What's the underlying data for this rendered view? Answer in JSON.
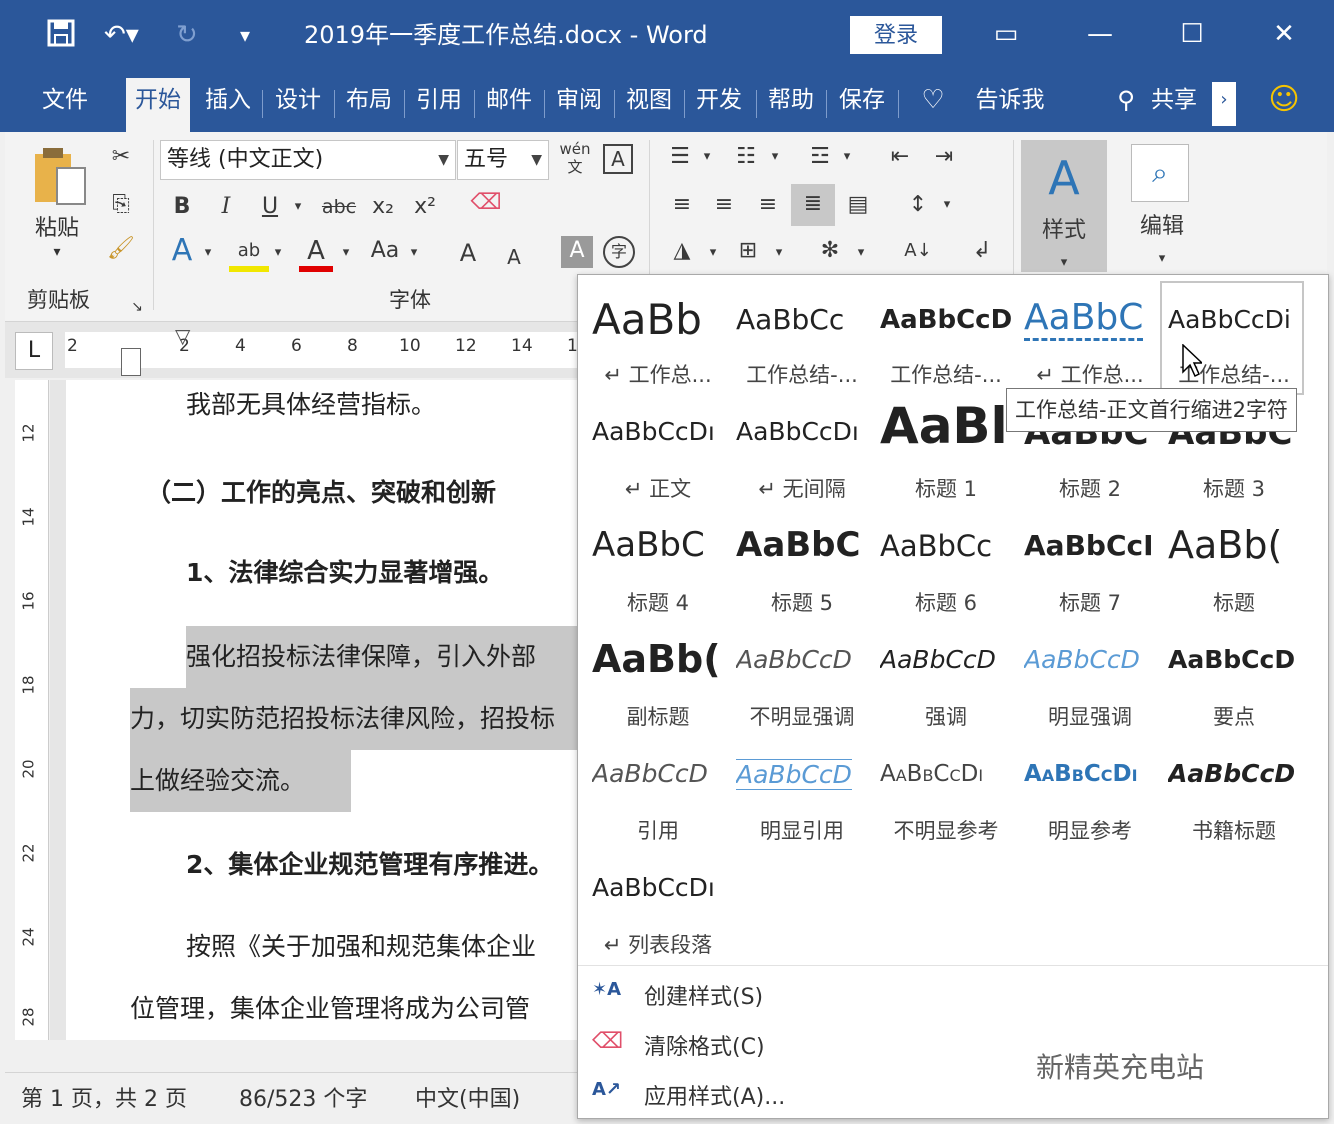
{
  "titlebar": {
    "title": "2019年一季度工作总结.docx  -  Word",
    "login": "登录",
    "save_icon": "save-icon",
    "undo_icon": "undo-icon",
    "redo_icon": "redo-icon"
  },
  "tabs": [
    "文件",
    "开始",
    "插入",
    "设计",
    "布局",
    "引用",
    "邮件",
    "审阅",
    "视图",
    "开发",
    "帮助",
    "保存"
  ],
  "active_tab": "开始",
  "tell_me": "告诉我",
  "share": "共享",
  "ribbon": {
    "paste": "粘贴",
    "clipboard": "剪贴板",
    "font_name": "等线 (中文正文)",
    "font_size": "五号",
    "font_group": "字体",
    "bold": "B",
    "italic": "I",
    "underline": "U",
    "strike": "abc",
    "sub": "x₂",
    "sup": "x²",
    "change_case": "Aa",
    "grow": "A",
    "shrink": "A",
    "styles": "样式",
    "editing": "编辑",
    "phonetic": "wén"
  },
  "ruler": {
    "corner": "L",
    "numbers": [
      "2",
      "2",
      "4",
      "6",
      "8",
      "10",
      "12",
      "14",
      "1"
    ],
    "vnumbers": [
      "12",
      "14",
      "16",
      "18",
      "20",
      "22",
      "24",
      "28"
    ]
  },
  "document": {
    "lines": [
      "我部无具体经营指标。",
      "（二）工作的亮点、突破和创新",
      "1、法律综合实力显著增强。",
      "强化招投标法律保障，引入外部",
      "力，切实防范招投标法律风险，招投标",
      "上做经验交流。",
      "2、集体企业规范管理有序推进。",
      "按照《关于加强和规范集体企业",
      "位管理，集体企业管理将成为公司管"
    ]
  },
  "statusbar": {
    "page": "第 1 页，共 2 页",
    "words": "86/523 个字",
    "lang": "中文(中国)"
  },
  "gallery": {
    "styles": [
      {
        "preview": "AaBb",
        "label": "↵ 工作总..."
      },
      {
        "preview": "AaBbCc",
        "label": "工作总结-..."
      },
      {
        "preview": "AaBbCcD",
        "label": "工作总结-..."
      },
      {
        "preview": "AaBbC",
        "label": "↵ 工作总..."
      },
      {
        "preview": "AaBbCcDi",
        "label": "工作总结-..."
      },
      {
        "preview": "AaBbCcDı",
        "label": "↵ 正文"
      },
      {
        "preview": "AaBbCcDı",
        "label": "↵ 无间隔"
      },
      {
        "preview": "AaBl",
        "label": "标题 1"
      },
      {
        "preview": "AaBbC",
        "label": "标题 2"
      },
      {
        "preview": "AaBbC",
        "label": "标题 3"
      },
      {
        "preview": "AaBbC",
        "label": "标题 4"
      },
      {
        "preview": "AaBbC",
        "label": "标题 5"
      },
      {
        "preview": "AaBbCc",
        "label": "标题 6"
      },
      {
        "preview": "AaBbCcI",
        "label": "标题 7"
      },
      {
        "preview": "AaBb(",
        "label": "标题"
      },
      {
        "preview": "AaBb(",
        "label": "副标题"
      },
      {
        "preview": "AaBbCcD",
        "label": "不明显强调"
      },
      {
        "preview": "AaBbCcD",
        "label": "强调"
      },
      {
        "preview": "AaBbCcD",
        "label": "明显强调"
      },
      {
        "preview": "AaBbCcD",
        "label": "要点"
      },
      {
        "preview": "AaBbCcD",
        "label": "引用"
      },
      {
        "preview": "AaBbCcD",
        "label": "明显引用"
      },
      {
        "preview": "AaBbCcDı",
        "label": "不明显参考"
      },
      {
        "preview": "AaBbCcDı",
        "label": "明显参考"
      },
      {
        "preview": "AaBbCcD",
        "label": "书籍标题"
      },
      {
        "preview": "AaBbCcDı",
        "label": "↵ 列表段落"
      }
    ],
    "menu": [
      "创建样式(S)",
      "清除格式(C)",
      "应用样式(A)..."
    ],
    "tooltip": "工作总结-正文首行缩进2字符"
  },
  "watermark": "新精英充电站",
  "colors": {
    "brand": "#2b579a",
    "accent_blue": "#2e75b6",
    "highlight": "#c8c8c8"
  }
}
